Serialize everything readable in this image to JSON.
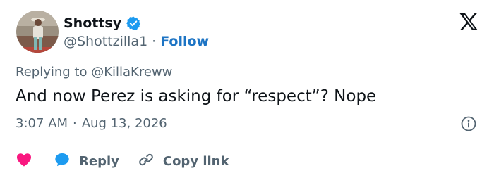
{
  "user": {
    "name": "Shottsy",
    "handle": "@Shottzilla1",
    "separator": "·",
    "follow_label": "Follow"
  },
  "tweet": {
    "replying_prefix": "Replying to",
    "replying_to": "@KillaKreww",
    "text": "And now Perez is asking for “respect”? Nope",
    "time": "3:07 AM",
    "date": "Aug 13, 2026",
    "meta_separator": "·"
  },
  "actions": {
    "reply_label": "Reply",
    "copy_link_label": "Copy link"
  },
  "icons": {
    "verified": "verified-badge-icon",
    "x_logo": "x-logo-icon",
    "info": "info-icon",
    "like": "heart-icon",
    "reply": "speech-bubble-icon",
    "copy": "link-icon"
  },
  "colors": {
    "accent": "#1d9bf0",
    "follow": "#1d74c4",
    "like": "#f91880",
    "muted": "#536471",
    "text": "#0f1419"
  }
}
